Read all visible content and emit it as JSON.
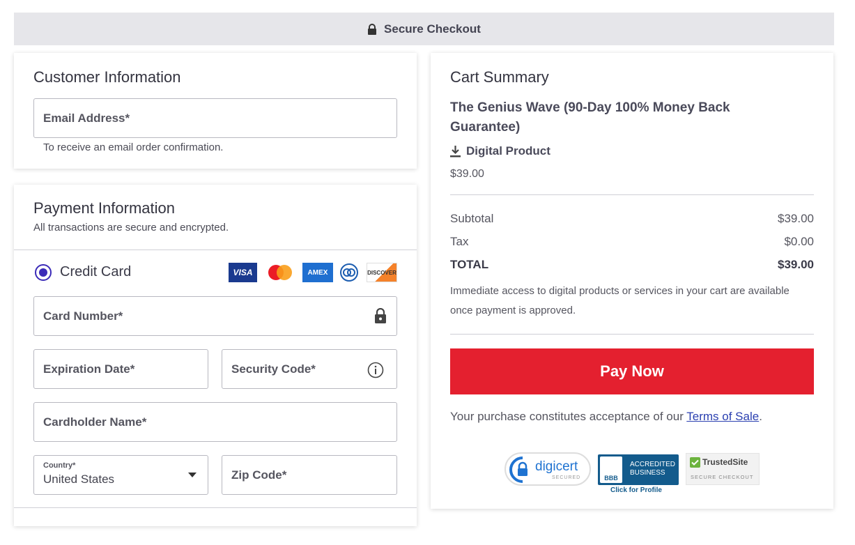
{
  "header": {
    "title": "Secure Checkout"
  },
  "customer": {
    "heading": "Customer Information",
    "email_label": "Email Address*",
    "email_hint": "To receive an email order confirmation."
  },
  "payment": {
    "heading": "Payment Information",
    "subheading": "All transactions are secure and encrypted.",
    "method_label": "Credit Card",
    "card_logos": [
      "VISA",
      "Mastercard",
      "AMEX",
      "Diners",
      "DISCOVER"
    ],
    "card_number_label": "Card Number*",
    "expiration_label": "Expiration Date*",
    "security_code_label": "Security Code*",
    "cardholder_label": "Cardholder Name*",
    "country_label": "Country*",
    "country_value": "United States",
    "zip_label": "Zip Code*"
  },
  "cart": {
    "heading": "Cart Summary",
    "product_name": "The Genius Wave (90-Day 100% Money Back Guarantee)",
    "product_type": "Digital Product",
    "product_price": "$39.00",
    "subtotal_label": "Subtotal",
    "subtotal_value": "$39.00",
    "tax_label": "Tax",
    "tax_value": "$0.00",
    "total_label": "TOTAL",
    "total_value": "$39.00",
    "access_note": "Immediate access to digital products or services in your cart are available once payment is approved.",
    "pay_button": "Pay Now",
    "acceptance_prefix": "Your purchase constitutes acceptance of our ",
    "terms_link": "Terms of Sale",
    "acceptance_suffix": "."
  },
  "badges": {
    "digicert": "digicert",
    "digicert_sub": "SECURED",
    "bbb_line1": "ACCREDITED",
    "bbb_line2": "BUSINESS",
    "bbb_mark": "BBB",
    "bbb_link": "Click for Profile",
    "trusted_title": "TrustedSite",
    "trusted_sub": "SECURE CHECKOUT"
  },
  "colors": {
    "accent": "#3b2bb8",
    "pay_button": "#e4202f",
    "link": "#2a3fb0",
    "header_bg": "#e6e6ea"
  }
}
